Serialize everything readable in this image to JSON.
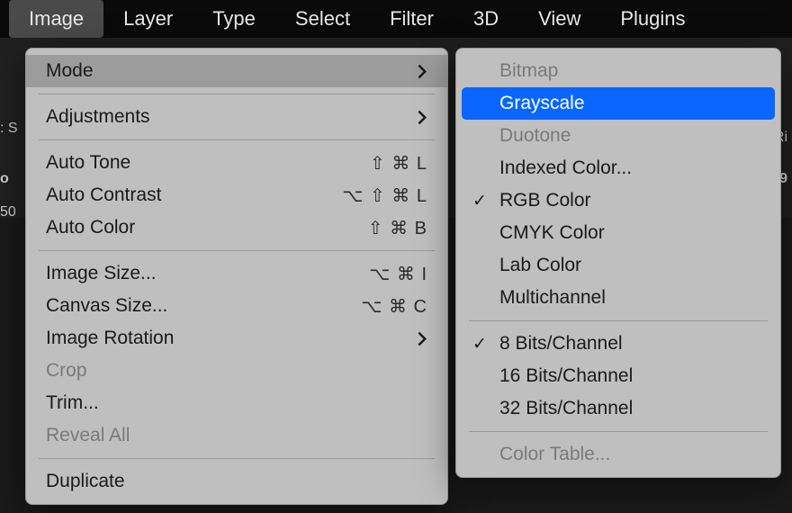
{
  "menubar": {
    "items": [
      "Image",
      "Layer",
      "Type",
      "Select",
      "Filter",
      "3D",
      "View",
      "Plugins"
    ],
    "active_index": 0
  },
  "bg": {
    "t1": ": S",
    "t2": "o",
    "t3": "50",
    "t4": "9",
    "t5": "Ri"
  },
  "dropdown": {
    "mode": "Mode",
    "adjustments": "Adjustments",
    "auto_tone": {
      "label": "Auto Tone",
      "shortcut": "⇧ ⌘ L"
    },
    "auto_contrast": {
      "label": "Auto Contrast",
      "shortcut": "⌥ ⇧ ⌘ L"
    },
    "auto_color": {
      "label": "Auto Color",
      "shortcut": "⇧ ⌘ B"
    },
    "image_size": {
      "label": "Image Size...",
      "shortcut": "⌥ ⌘ I"
    },
    "canvas_size": {
      "label": "Canvas Size...",
      "shortcut": "⌥ ⌘ C"
    },
    "image_rotation": "Image Rotation",
    "crop": "Crop",
    "trim": "Trim...",
    "reveal_all": "Reveal All",
    "duplicate": "Duplicate"
  },
  "submenu": {
    "bitmap": "Bitmap",
    "grayscale": "Grayscale",
    "duotone": "Duotone",
    "indexed": "Indexed Color...",
    "rgb": "RGB Color",
    "cmyk": "CMYK Color",
    "lab": "Lab Color",
    "multichannel": "Multichannel",
    "bits8": "8 Bits/Channel",
    "bits16": "16 Bits/Channel",
    "bits32": "32 Bits/Channel",
    "color_table": "Color Table..."
  }
}
